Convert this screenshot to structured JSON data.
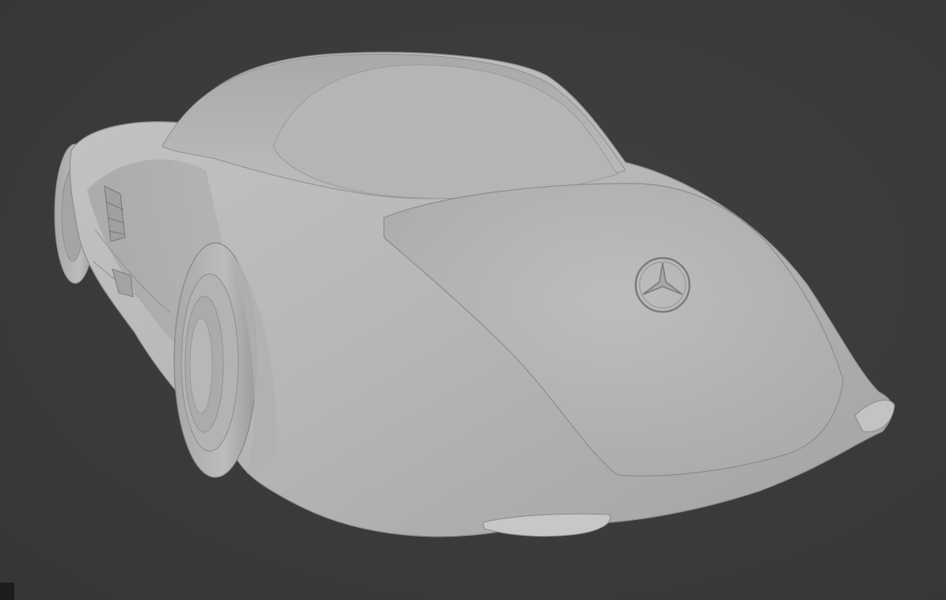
{
  "viewport": {
    "mode": "solid-shading",
    "background_color": "#3a3a3a",
    "model_color": "#b9b9b9"
  },
  "scene": {
    "object": "car-body-model",
    "emblem": "three-pointed-star-emblem"
  }
}
